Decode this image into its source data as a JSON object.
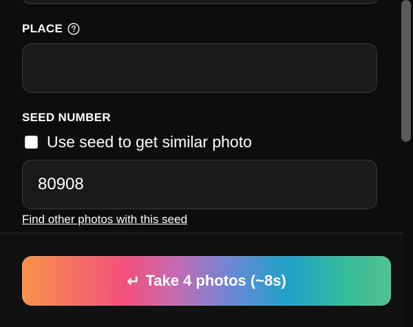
{
  "form": {
    "place": {
      "label": "PLACE",
      "value": "",
      "help_icon": "question-circle-icon"
    },
    "seed": {
      "label": "SEED NUMBER",
      "checkbox_label": "Use seed to get similar photo",
      "checkbox_checked": false,
      "value": "80908",
      "link_text": "Find other photos with this seed"
    }
  },
  "footer": {
    "button_icon": "↵",
    "button_label": "Take 4 photos (~8s)"
  }
}
